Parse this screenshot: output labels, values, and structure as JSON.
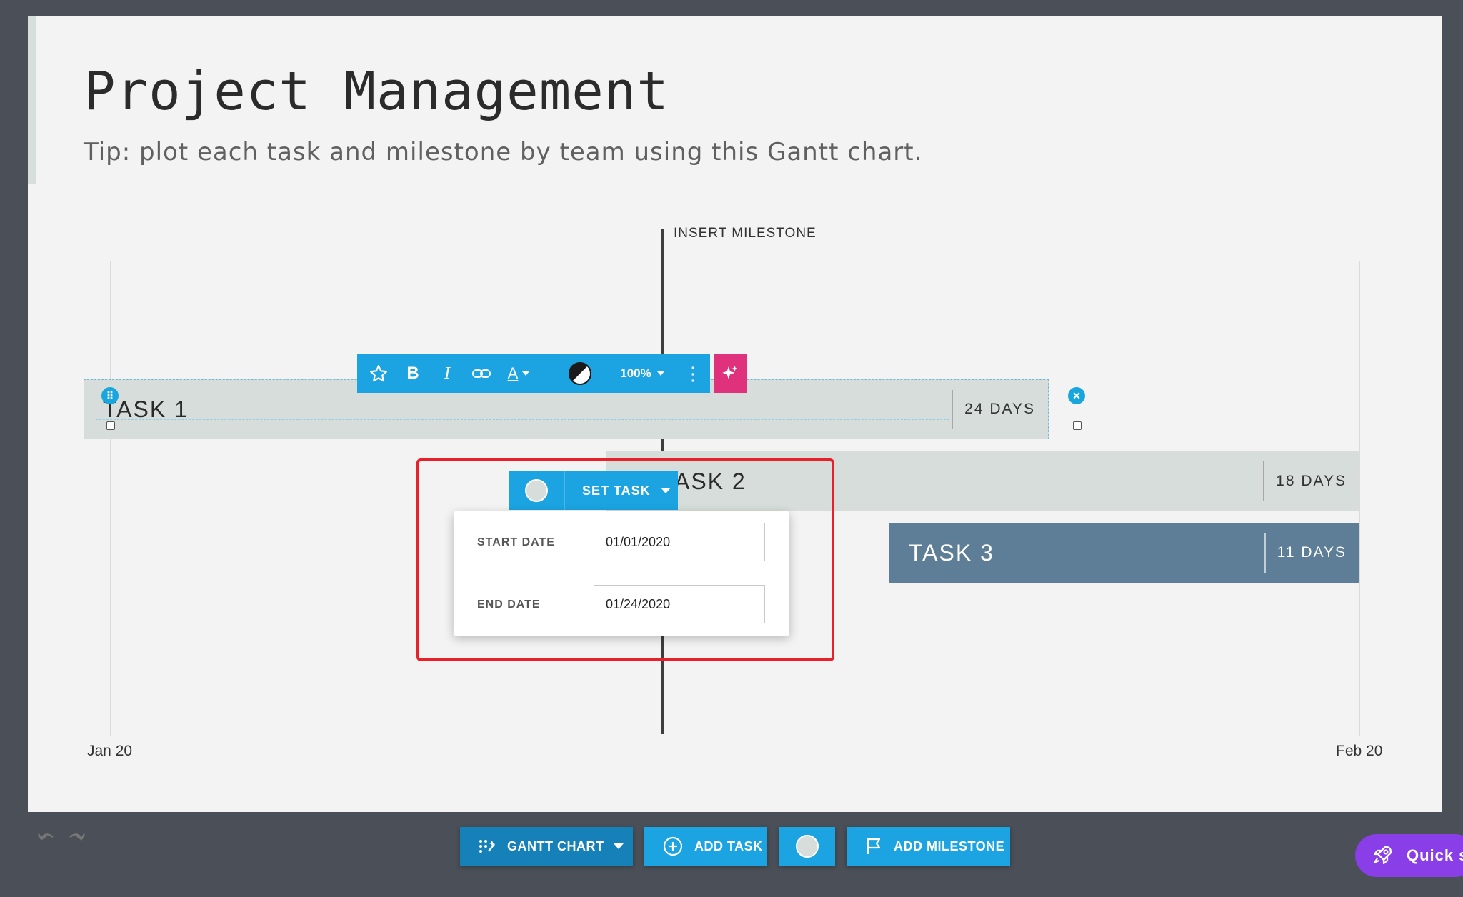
{
  "slide": {
    "title": "Project Management",
    "subtitle": "Tip: plot each task and milestone by team using this Gantt chart."
  },
  "timeline": {
    "milestone_label": "INSERT MILESTONE",
    "start_label": "Jan 20",
    "end_label": "Feb 20"
  },
  "tasks": [
    {
      "name": "TASK 1",
      "duration": "24 DAYS",
      "color": "#d6ddda"
    },
    {
      "name": "TASK 2",
      "name_visible": "ASK 2",
      "duration": "18 DAYS",
      "color": "#d6ddda"
    },
    {
      "name": "TASK 3",
      "duration": "11 DAYS",
      "color": "#5d7e96"
    }
  ],
  "format_toolbar": {
    "opacity": "100%",
    "icons": [
      "star-icon",
      "bold-icon",
      "italic-icon",
      "link-icon",
      "text-color-icon",
      "contrast-icon",
      "more-vertical-icon",
      "sparkle-icon"
    ]
  },
  "set_task_popup": {
    "label": "SET TASK",
    "start_date_label": "START DATE",
    "start_date": "01/01/2020",
    "end_date_label": "END DATE",
    "end_date": "01/24/2020"
  },
  "bottom_toolbar": {
    "gantt_chart": "GANTT CHART",
    "add_task": "ADD TASK",
    "add_milestone": "ADD MILESTONE",
    "quick": "Quick s"
  },
  "colors": {
    "accent": "#1ba4e1",
    "magic": "#e0317c",
    "highlight": "#e8202a",
    "quick": "#8a3ee8"
  }
}
